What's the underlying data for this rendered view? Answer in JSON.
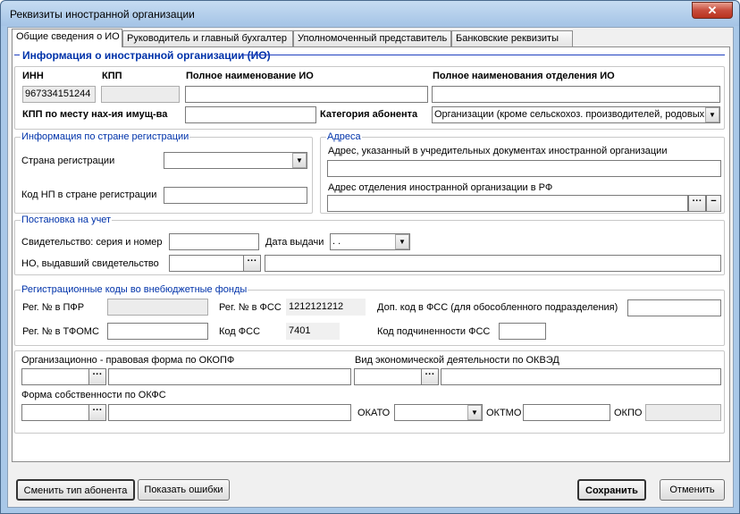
{
  "window": {
    "title": "Реквизиты иностранной организации",
    "close_symbol": "✕"
  },
  "tabs": [
    {
      "label": "Общие сведения о ИО",
      "active": true
    },
    {
      "label": "Руководитель и главный бухгалтер",
      "active": false
    },
    {
      "label": "Уполномоченный представитель",
      "active": false
    },
    {
      "label": "Банковские реквизиты",
      "active": false
    }
  ],
  "section_header": "Информация о иностранной организации (ИО)",
  "org": {
    "inn_label": "ИНН",
    "inn_value": "967334151244",
    "kpp_label": "КПП",
    "kpp_value": "",
    "full_name_label": "Полное наименование ИО",
    "full_name_value": "",
    "branch_name_label": "Полное наименования отделения ИО",
    "branch_name_value": "",
    "kpp_property_label": "КПП по месту нах-ия имущ-ва",
    "kpp_property_value": "",
    "category_label": "Категория абонента",
    "category_value": "Организации (кроме сельскохоз. производителей, родовых"
  },
  "registration_country": {
    "group_title": "Информация по стране регистрации",
    "country_label": "Страна регистрации",
    "country_value": "",
    "taxid_label": "Код НП в стране регистрации",
    "taxid_value": ""
  },
  "addresses": {
    "group_title": "Адреса",
    "founding_label": "Адрес, указанный в учредительных документах иностранной организации",
    "founding_value": "",
    "branch_label": "Адрес отделения иностранной организации в РФ",
    "branch_value": "",
    "minus_symbol": "−"
  },
  "tax_registration": {
    "group_title": "Постановка на учет",
    "cert_label": "Свидетельство: серия и номер",
    "cert_value": "",
    "date_label": "Дата выдачи",
    "date_value": ". .",
    "issuer_label": "НО, выдавший свидетельство",
    "issuer_code": "",
    "issuer_name": ""
  },
  "funds": {
    "group_title": "Регистрационные коды во внебюджетные фонды",
    "pfr_label": "Рег. № в ПФР",
    "pfr_value": "",
    "fss_label": "Рег. № в ФСС",
    "fss_value": "1212121212",
    "fss_extra_label": "Доп. код в ФСС (для обособленного подразделения)",
    "fss_extra_value": "",
    "tfoms_label": "Рег. № в ТФОМС",
    "tfoms_value": "",
    "fss_code_label": "Код ФСС",
    "fss_code_value": "7401",
    "fss_sub_label": "Код подчиненности ФСС",
    "fss_sub_value": ""
  },
  "classifiers": {
    "okopf_label": "Организационно - правовая форма по ОКОПФ",
    "okopf_code": "",
    "okopf_name": "",
    "okved_label": "Вид экономической деятельности по ОКВЭД",
    "okved_code": "",
    "okved_name": "",
    "okfs_label": "Форма собственности по ОКФС",
    "okfs_code": "",
    "okfs_name": "",
    "okato_label": "ОКАТО",
    "okato_value": "",
    "oktmo_label": "ОКТМО",
    "oktmo_value": "",
    "okpo_label": "ОКПО",
    "okpo_value": ""
  },
  "ellipsis": "···",
  "dropdown_arrow": "▼",
  "buttons": {
    "change_type": "Сменить тип абонента",
    "show_errors": "Показать ошибки",
    "save": "Сохранить",
    "cancel": "Отменить"
  }
}
